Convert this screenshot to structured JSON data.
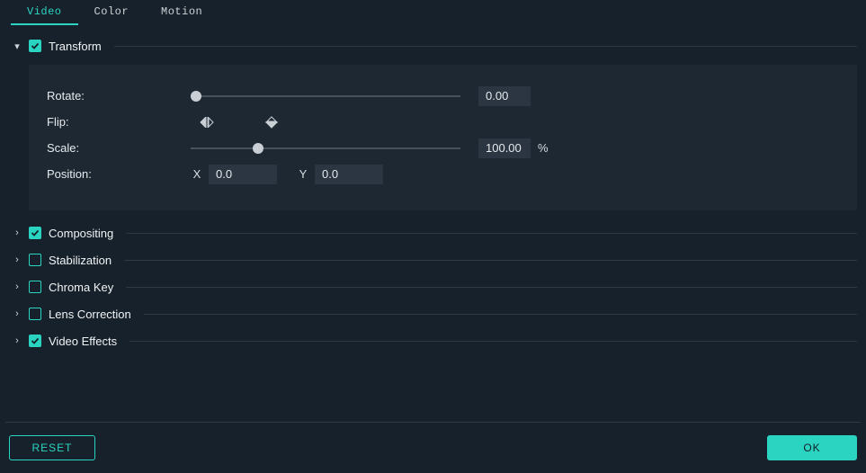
{
  "tabs": {
    "video": "Video",
    "color": "Color",
    "motion": "Motion",
    "active": "video"
  },
  "sections": {
    "transform": {
      "label": "Transform",
      "checked": true,
      "expanded": true
    },
    "compositing": {
      "label": "Compositing",
      "checked": true,
      "expanded": false
    },
    "stabilization": {
      "label": "Stabilization",
      "checked": false,
      "expanded": false
    },
    "chromaKey": {
      "label": "Chroma Key",
      "checked": false,
      "expanded": false
    },
    "lensCorrection": {
      "label": "Lens Correction",
      "checked": false,
      "expanded": false
    },
    "videoEffects": {
      "label": "Video Effects",
      "checked": true,
      "expanded": false
    }
  },
  "transform": {
    "rotateLabel": "Rotate:",
    "rotateValue": "0.00",
    "rotateSliderPos": 0,
    "flipLabel": "Flip:",
    "scaleLabel": "Scale:",
    "scaleValue": "100.00",
    "scaleSliderPos": 25,
    "scaleUnit": "%",
    "positionLabel": "Position:",
    "posXLabel": "X",
    "posXValue": "0.0",
    "posYLabel": "Y",
    "posYValue": "0.0"
  },
  "buttons": {
    "reset": "RESET",
    "ok": "OK"
  },
  "colors": {
    "accent": "#2bd4c0",
    "bg": "#17212b",
    "panel": "#1d2833",
    "input": "#2b3642"
  }
}
